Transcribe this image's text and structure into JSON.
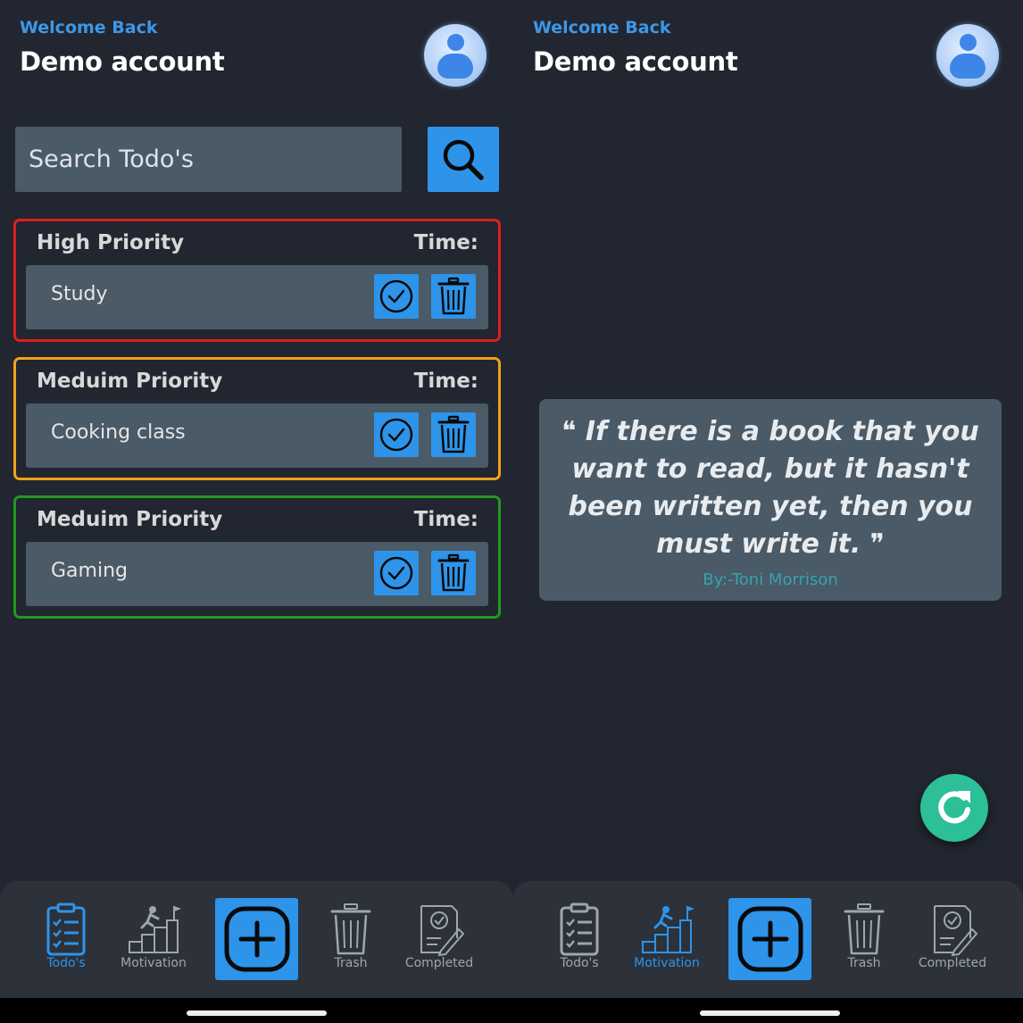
{
  "left": {
    "header": {
      "welcome": "Welcome Back",
      "account": "Demo account"
    },
    "search": {
      "placeholder": "Search Todo's"
    },
    "todos": [
      {
        "priority": "High Priority",
        "time_label": "Time:",
        "task": "Study",
        "border_color": "#e01f1f"
      },
      {
        "priority": "Meduim Priority",
        "time_label": "Time:",
        "task": "Cooking class",
        "border_color": "#f0a218"
      },
      {
        "priority": "Meduim Priority",
        "time_label": "Time:",
        "task": "Gaming",
        "border_color": "#1f9a1f"
      }
    ],
    "nav": {
      "todos": "Todo's",
      "motivation": "Motivation",
      "trash": "Trash",
      "completed": "Completed",
      "active": "todos"
    }
  },
  "right": {
    "header": {
      "welcome": "Welcome Back",
      "account": "Demo account"
    },
    "quote": {
      "text": "If there is a book that you want to read, but it hasn't been written yet, then you must write it.",
      "open_mark": "❝",
      "close_mark": "❞",
      "author": "By:-Toni Morrison"
    },
    "nav": {
      "todos": "Todo's",
      "motivation": "Motivation",
      "trash": "Trash",
      "completed": "Completed",
      "active": "motivation"
    }
  },
  "colors": {
    "accent": "#2e94ea",
    "background": "#222630",
    "card": "#4a5a66",
    "refresh": "#2cbf98",
    "welcome": "#3d98e6"
  }
}
